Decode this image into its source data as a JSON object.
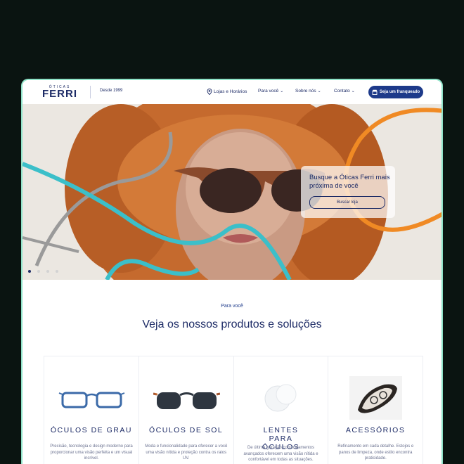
{
  "brand": {
    "small": "ÓTICAS",
    "name": "FERRI",
    "since": "Desde 1999"
  },
  "nav": {
    "stores": "Lojas e Horários",
    "for_you": "Para você",
    "about": "Sobre nós",
    "contact": "Contato",
    "cta": "Seja um franqueado"
  },
  "hero": {
    "card_title": "Busque a Óticas Ferri mais próxima de você",
    "card_button": "Buscar loja",
    "slides": 4,
    "active_slide": 1
  },
  "section": {
    "eyebrow": "Para você",
    "title": "Veja os nossos produtos e soluções"
  },
  "products": [
    {
      "title": "ÓCULOS DE GRAU",
      "desc": "Precisão, tecnologia e design moderno para proporcionar uma visão perfeita e um visual incrível."
    },
    {
      "title": "ÓCULOS DE SOL",
      "desc": "Moda e funcionalidade para oferecer a você uma visão nítida e proteção contra os raios UV."
    },
    {
      "title": "LENTES PARA ÓCULOS",
      "desc": "De última geração com tratamentos avançados oferecem uma visão nítida e confortável em todas as situações."
    },
    {
      "title": "ACESSÓRIOS",
      "desc": "Refinamento em cada detalhe. Estojos e panos de limpeza, onde estilo encontra praticidade."
    }
  ],
  "colors": {
    "navy": "#1d2b66",
    "accent_teal": "#3bbfc9",
    "accent_orange": "#f08a24",
    "frame": "#8fe3c8"
  }
}
